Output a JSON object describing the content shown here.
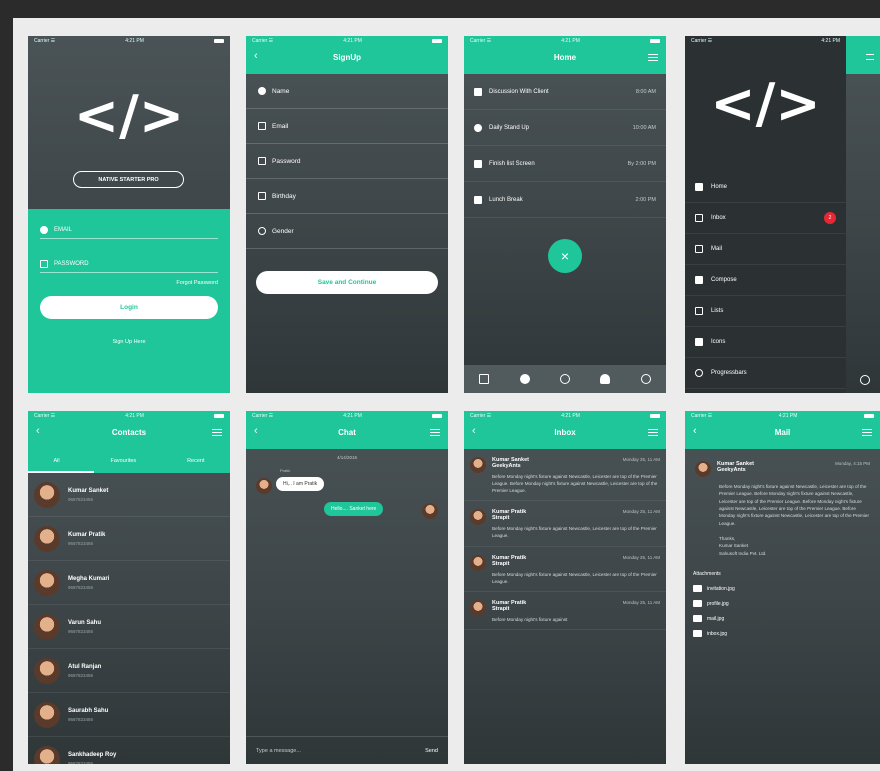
{
  "status": {
    "carrier": "Carrier ☰",
    "time": "4:21 PM"
  },
  "login": {
    "logo": "</>",
    "brand": "NATIVE STARTER PRO",
    "email_label": "EMAIL",
    "password_label": "PASSWORD",
    "forgot": "Forgot Password",
    "login_button": "Login",
    "signup_link": "Sign Up Here"
  },
  "signup": {
    "title": "SignUp",
    "fields": [
      "Name",
      "Email",
      "Password",
      "Birthday",
      "Gender"
    ],
    "save_button": "Save and Continue"
  },
  "home": {
    "title": "Home",
    "rows": [
      {
        "title": "Discussion With Client",
        "time": "8:00 AM"
      },
      {
        "title": "Daily Stand Up",
        "time": "10:00 AM"
      },
      {
        "title": "Finish list Screen",
        "time": "By 2:00 PM"
      },
      {
        "title": "Lunch Break",
        "time": "2:00 PM"
      }
    ],
    "fab": "×"
  },
  "drawer": {
    "logo": "</>",
    "items": [
      "Home",
      "Inbox",
      "Mail",
      "Compose",
      "Lists",
      "Icons",
      "Progressbars"
    ],
    "inbox_badge": "2"
  },
  "contacts": {
    "title": "Contacts",
    "tabs": [
      "All",
      "Favourites",
      "Recent"
    ],
    "people": [
      {
        "name": "Kumar Sanket",
        "phone": "9687823456"
      },
      {
        "name": "Kumar Pratik",
        "phone": "9687823456"
      },
      {
        "name": "Megha Kumari",
        "phone": "9687823456"
      },
      {
        "name": "Varun Sahu",
        "phone": "9687823456"
      },
      {
        "name": "Atul Ranjan",
        "phone": "9687823456"
      },
      {
        "name": "Saurabh Sahu",
        "phone": "9687823456"
      },
      {
        "name": "Sankhadeep Roy",
        "phone": "9687823456"
      }
    ]
  },
  "chat": {
    "title": "Chat",
    "date": "4/14/2016",
    "sender": "Pratik",
    "incoming": "Hi,.. I am Pratik",
    "outgoing": "Hello.... Sanket here",
    "input_placeholder": "Type a message...",
    "send": "Send"
  },
  "inbox": {
    "title": "Inbox",
    "messages": [
      {
        "from": "Kumar Sanket",
        "org": "GeekyAnts",
        "date": "Monday 25, 11 AM",
        "text": "Before Monday night's fixture against Newcastle, Leicester are top of the Premier League. Before Monday night's fixture against Newcastle, Leicester are top of the Premier League."
      },
      {
        "from": "Kumar Pratik",
        "org": "Strapit",
        "date": "Monday 25, 11 AM",
        "text": "Before Monday night's fixture against Newcastle, Leicester are top of the Premier League."
      },
      {
        "from": "Kumar Pratik",
        "org": "Strapit",
        "date": "Monday 25, 11 AM",
        "text": "Before Monday night's fixture against Newcastle, Leicester are top of the Premier League."
      },
      {
        "from": "Kumar Pratik",
        "org": "Strapit",
        "date": "Monday 25, 11 AM",
        "text": "Before Monday night's fixture against"
      }
    ]
  },
  "mail": {
    "title": "Mail",
    "from": "Kumar Sanket",
    "org": "GeekyAnts",
    "date": "Monday, 4:15 PM",
    "body": "Before Monday night's fixture against Newcastle, Leicester are top of the Premier League. Before Monday night's fixture against Newcastle, Leicester are top of the Premier League. Before Monday night's fixture against Newcastle, Leicester are top of the Premier League. Before Monday night's fixture against Newcastle, Leicester are top of the Premier League.",
    "thanks": "Thanks,",
    "sign_name": "Kumar Sanket",
    "sign_co": "Sahusoft India Pvt. Ltd.",
    "attachments_label": "Attachments",
    "attachments": [
      "invitation.jpg",
      "profile.jpg",
      "mail.jpg",
      "inbox.jpg"
    ]
  }
}
